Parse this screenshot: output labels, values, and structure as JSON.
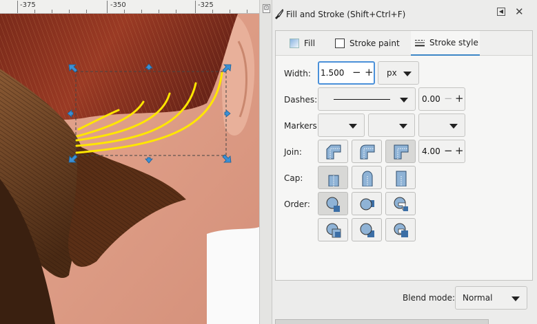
{
  "ruler": {
    "labels": [
      "-375",
      "-350",
      "-325"
    ]
  },
  "dialog": {
    "title": "Fill and Stroke (Shift+Ctrl+F)",
    "tabs": [
      {
        "label": "Fill",
        "icon": "fill-icon"
      },
      {
        "label": "Stroke paint",
        "icon": "stroke-paint-icon"
      },
      {
        "label": "Stroke style",
        "icon": "stroke-style-icon",
        "active": true
      }
    ],
    "width": {
      "label": "Width:",
      "value": "1.500",
      "unit": "px"
    },
    "dashes": {
      "label": "Dashes:",
      "offset": "0.00"
    },
    "markers": {
      "label": "Markers:"
    },
    "join": {
      "label": "Join:",
      "miter_limit": "4.00",
      "options": [
        "bevel-join",
        "round-join",
        "miter-join"
      ],
      "selected": "miter-join"
    },
    "cap": {
      "label": "Cap:",
      "options": [
        "butt-cap",
        "round-cap",
        "square-cap"
      ],
      "selected": "butt-cap"
    },
    "order": {
      "label": "Order:",
      "selected": 0
    },
    "blend": {
      "label": "Blend mode:",
      "value": "Normal"
    }
  },
  "colors": {
    "accent": "#3b86c6",
    "selection_handle": "#3b8fd4",
    "stroke_yellow": "#ffe600"
  }
}
